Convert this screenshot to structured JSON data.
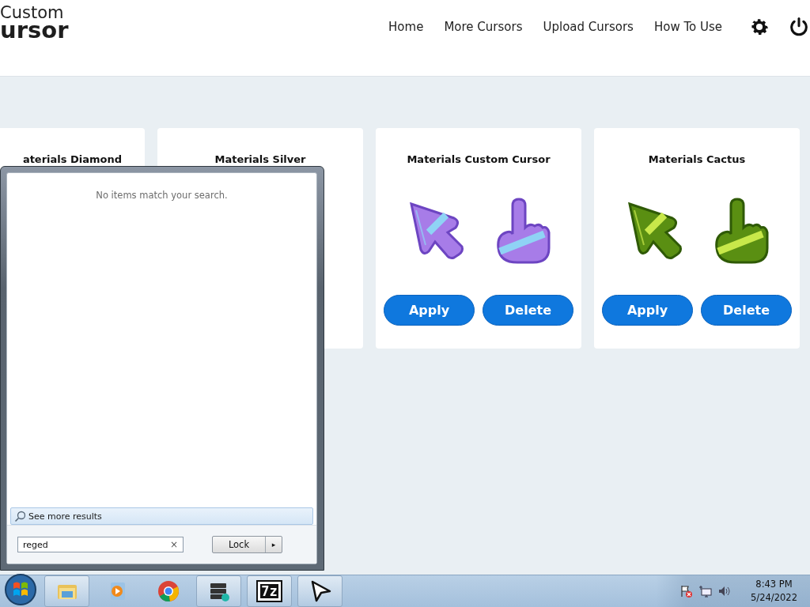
{
  "header": {
    "logo": {
      "line_1": "Custom",
      "line_2": "ursor"
    },
    "nav": [
      {
        "label": "Home"
      },
      {
        "label": "More Cursors"
      },
      {
        "label": "Upload Cursors"
      },
      {
        "label": "How To Use"
      }
    ],
    "icons": [
      {
        "kind": "settings"
      },
      {
        "kind": "power"
      }
    ]
  },
  "cards": [
    {
      "title": "aterials Diamond"
    },
    {
      "title": "Materials Silver"
    },
    {
      "title": "Materials Custom Cursor",
      "kind": "crystal",
      "buttons": [
        {
          "label": "Apply"
        },
        {
          "label": "Delete"
        }
      ]
    },
    {
      "title": "Materials Cactus",
      "kind": "cactus",
      "buttons": [
        {
          "label": "Apply"
        },
        {
          "label": "Delete"
        }
      ]
    }
  ],
  "start_menu": {
    "message": "No items match your search.",
    "see_more": "See more results",
    "search": {
      "value": "reged"
    },
    "clear": "×",
    "power_button": "Lock",
    "power_arrow": "▸"
  },
  "taskbar": {
    "apps": [
      {
        "kind": "explorer"
      },
      {
        "kind": "media"
      },
      {
        "kind": "chrome"
      },
      {
        "kind": "server"
      },
      {
        "kind": "archive",
        "label": "7z"
      },
      {
        "kind": "cursor"
      }
    ],
    "tray": [
      {
        "kind": "flag"
      },
      {
        "kind": "network"
      },
      {
        "kind": "volume"
      }
    ],
    "time": "8:43 PM",
    "date": "5/24/2022"
  }
}
